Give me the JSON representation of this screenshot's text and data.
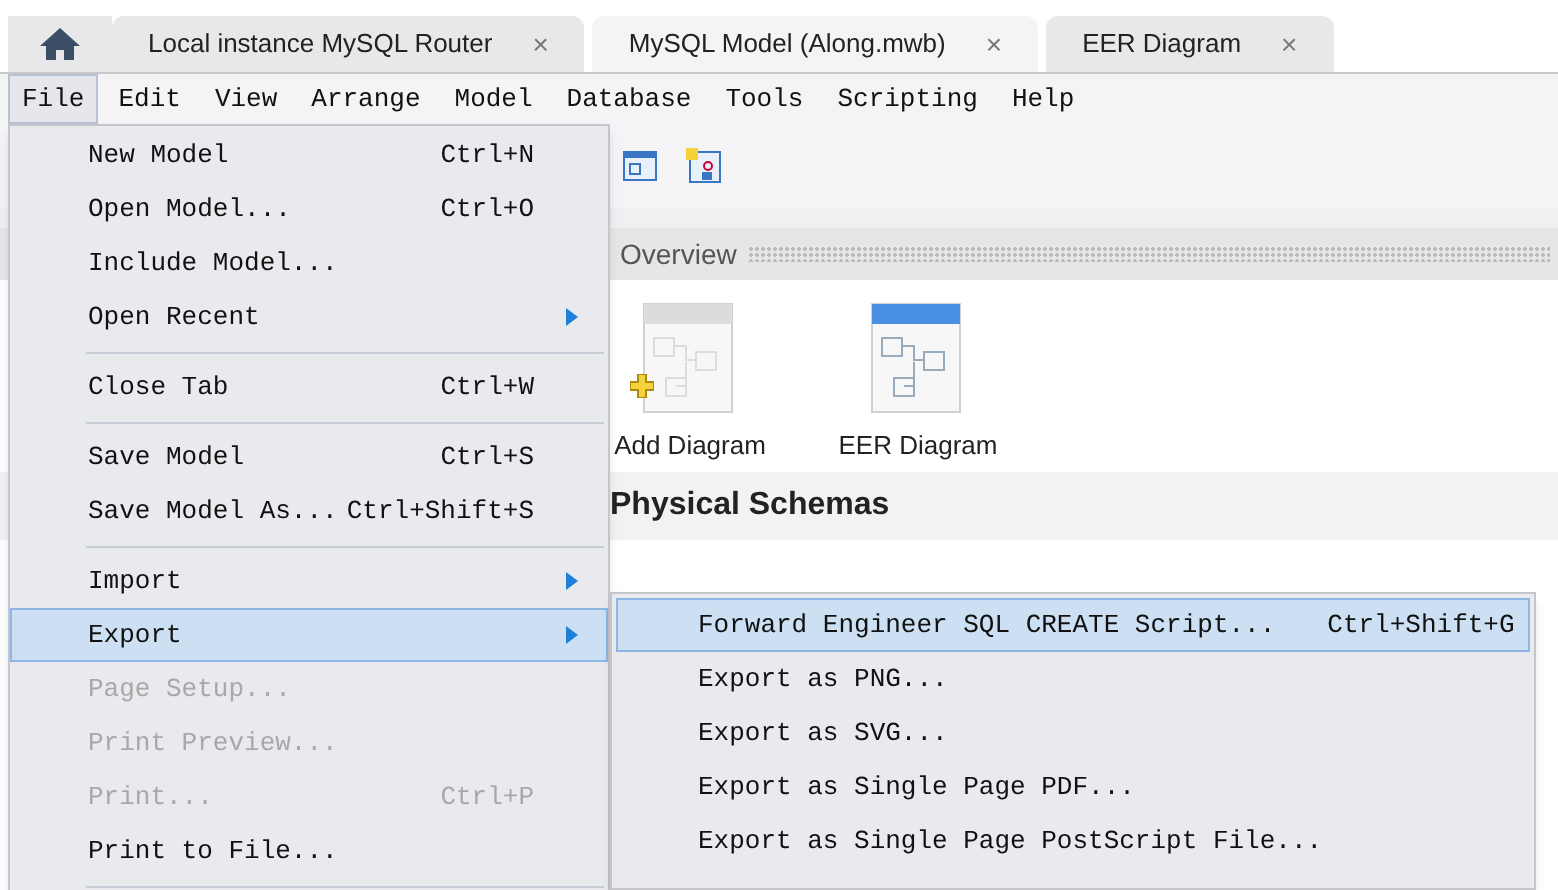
{
  "tabs": [
    {
      "label": "Local instance MySQL Router",
      "close": "×",
      "selected": false
    },
    {
      "label": "MySQL Model (Along.mwb)",
      "close": "×",
      "selected": true
    },
    {
      "label": "EER Diagram",
      "close": "×",
      "selected": false
    }
  ],
  "menubar": [
    {
      "label": "File",
      "selected": true
    },
    {
      "label": "Edit",
      "selected": false
    },
    {
      "label": "View",
      "selected": false
    },
    {
      "label": "Arrange",
      "selected": false
    },
    {
      "label": "Model",
      "selected": false
    },
    {
      "label": "Database",
      "selected": false
    },
    {
      "label": "Tools",
      "selected": false
    },
    {
      "label": "Scripting",
      "selected": false
    },
    {
      "label": "Help",
      "selected": false
    }
  ],
  "overview": {
    "title": "Overview",
    "diagrams": [
      {
        "label": "Add Diagram",
        "kind": "add"
      },
      {
        "label": "EER Diagram",
        "kind": "diagram"
      }
    ],
    "schemas_title": "Physical Schemas"
  },
  "file_menu": [
    {
      "kind": "item",
      "label": "New Model",
      "shortcut": "Ctrl+N",
      "disabled": false,
      "submenu": false,
      "selected": false
    },
    {
      "kind": "item",
      "label": "Open Model...",
      "shortcut": "Ctrl+O",
      "disabled": false,
      "submenu": false,
      "selected": false
    },
    {
      "kind": "item",
      "label": "Include Model...",
      "disabled": false,
      "submenu": false,
      "selected": false
    },
    {
      "kind": "item",
      "label": "Open Recent",
      "disabled": false,
      "submenu": true,
      "selected": false
    },
    {
      "kind": "separator"
    },
    {
      "kind": "item",
      "label": "Close Tab",
      "shortcut": "Ctrl+W",
      "disabled": false,
      "submenu": false,
      "selected": false
    },
    {
      "kind": "separator"
    },
    {
      "kind": "item",
      "label": "Save Model",
      "shortcut": "Ctrl+S",
      "disabled": false,
      "submenu": false,
      "selected": false
    },
    {
      "kind": "item",
      "label": "Save Model As...",
      "shortcut": "Ctrl+Shift+S",
      "disabled": false,
      "submenu": false,
      "selected": false
    },
    {
      "kind": "separator"
    },
    {
      "kind": "item",
      "label": "Import",
      "disabled": false,
      "submenu": true,
      "selected": false
    },
    {
      "kind": "item",
      "label": "Export",
      "disabled": false,
      "submenu": true,
      "selected": true
    },
    {
      "kind": "item",
      "label": "Page Setup...",
      "disabled": true,
      "submenu": false,
      "selected": false
    },
    {
      "kind": "item",
      "label": "Print Preview...",
      "disabled": true,
      "submenu": false,
      "selected": false
    },
    {
      "kind": "item",
      "label": "Print...",
      "shortcut": "Ctrl+P",
      "disabled": true,
      "submenu": false,
      "selected": false
    },
    {
      "kind": "item",
      "label": "Print to File...",
      "disabled": false,
      "submenu": false,
      "selected": false
    },
    {
      "kind": "separator"
    }
  ],
  "export_menu": [
    {
      "label": "Forward Engineer SQL CREATE Script...",
      "shortcut": "Ctrl+Shift+G",
      "selected": true
    },
    {
      "label": "Export as PNG...",
      "selected": false
    },
    {
      "label": "Export as SVG...",
      "selected": false
    },
    {
      "label": "Export as Single Page PDF...",
      "selected": false
    },
    {
      "label": "Export as Single Page PostScript File...",
      "selected": false
    }
  ]
}
